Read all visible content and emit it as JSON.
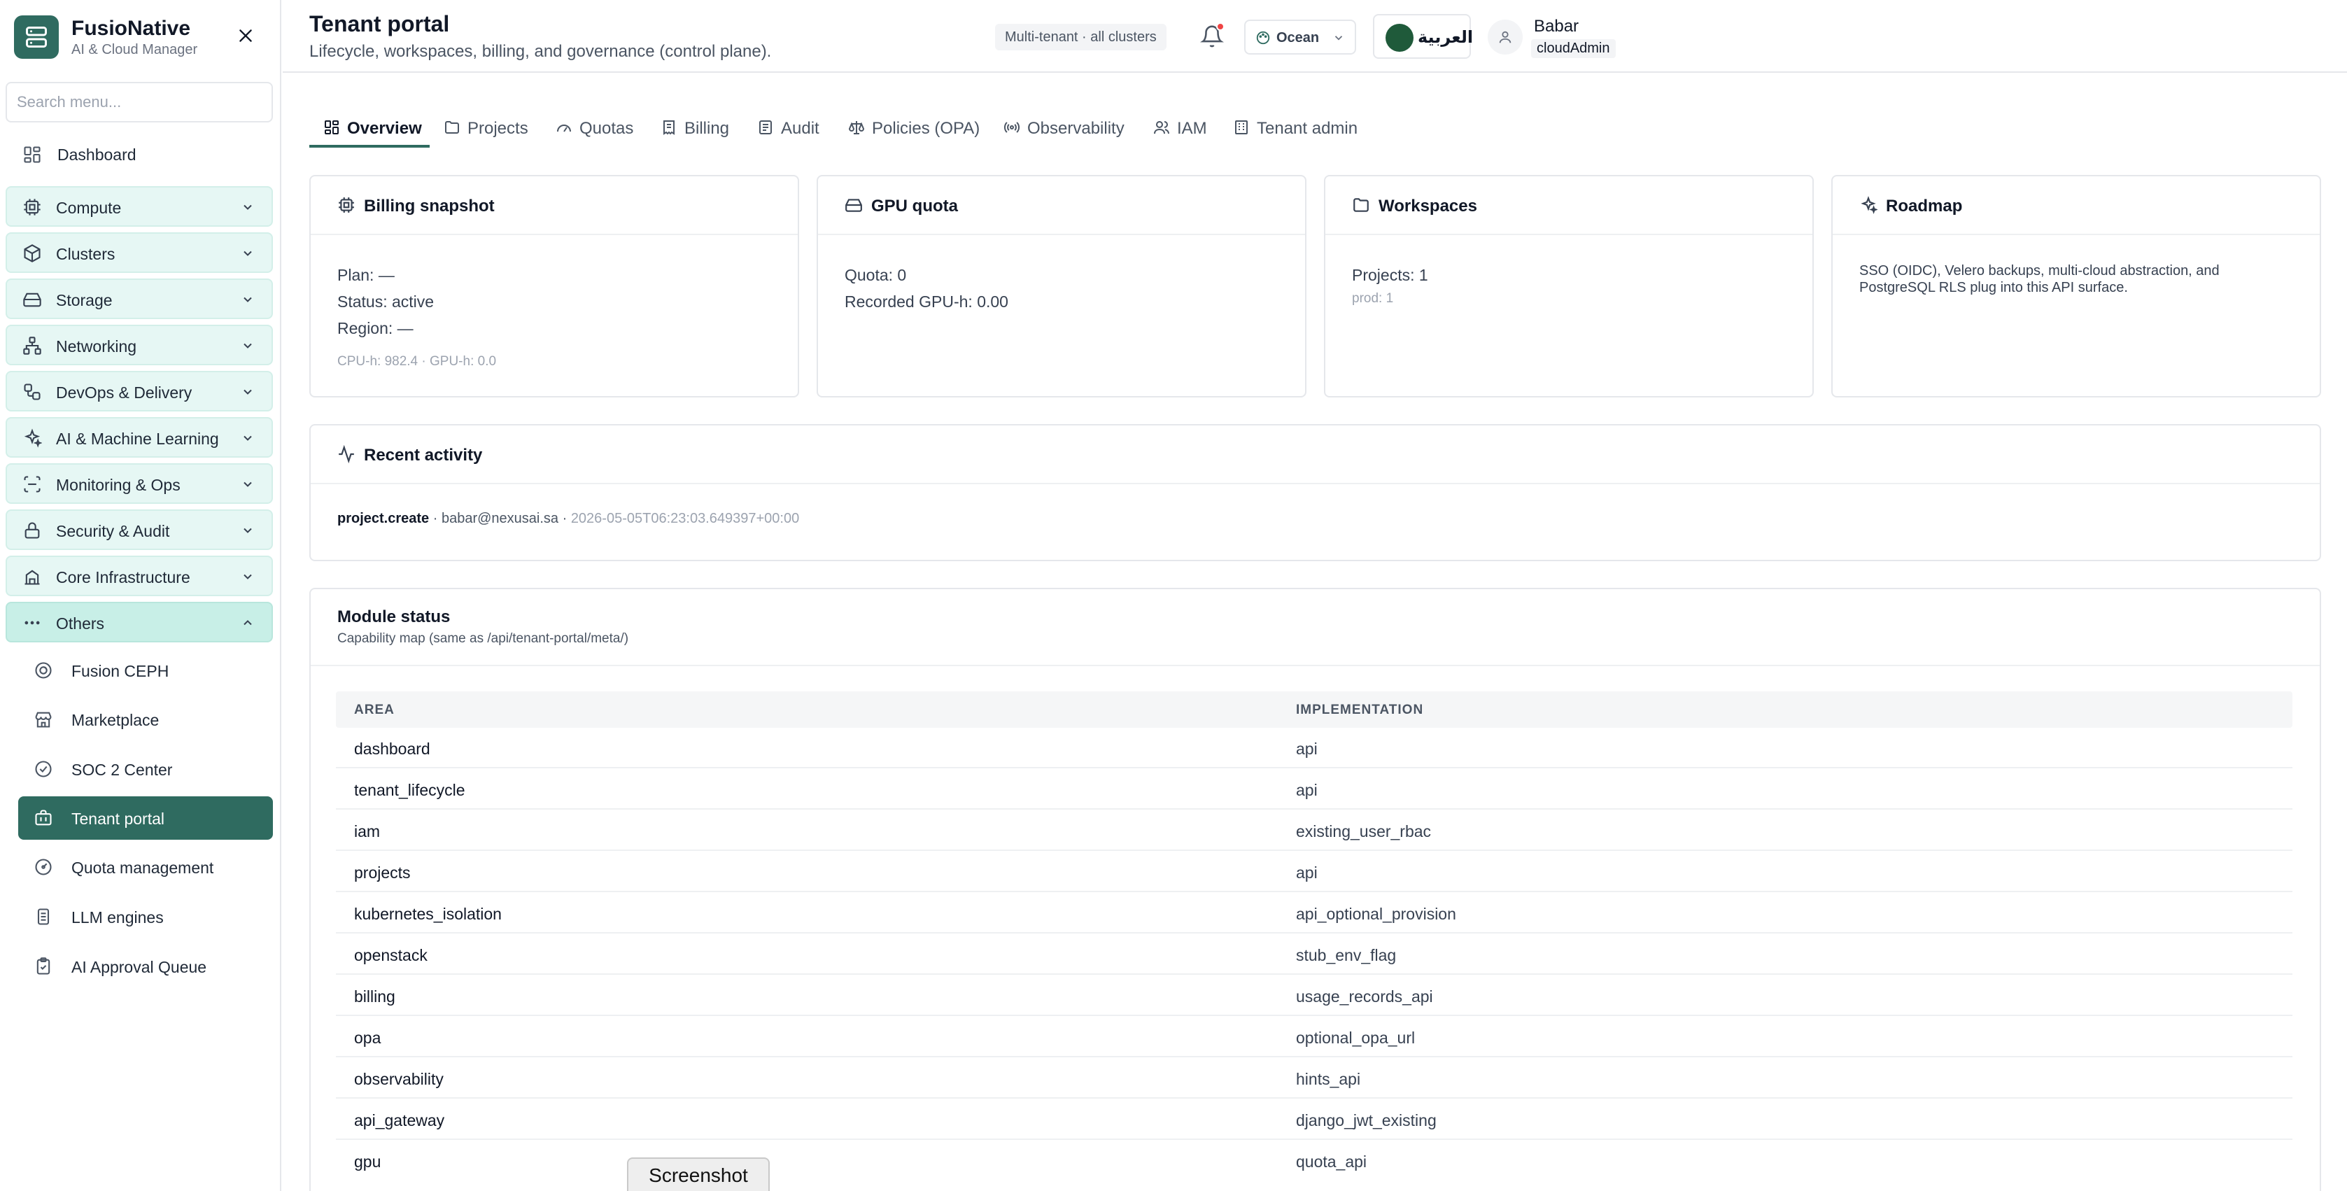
{
  "brand": {
    "name": "FusioNative",
    "subtitle": "AI & Cloud Manager"
  },
  "sidebar": {
    "search_placeholder": "Search menu...",
    "dashboard": "Dashboard",
    "groups": [
      {
        "label": "Compute",
        "icon": "cpu-icon"
      },
      {
        "label": "Clusters",
        "icon": "cube-icon"
      },
      {
        "label": "Storage",
        "icon": "hard-drive-icon"
      },
      {
        "label": "Networking",
        "icon": "network-icon"
      },
      {
        "label": "DevOps & Delivery",
        "icon": "workflow-icon"
      },
      {
        "label": "AI & Machine Learning",
        "icon": "sparkles-icon"
      },
      {
        "label": "Monitoring & Ops",
        "icon": "scan-icon"
      },
      {
        "label": "Security & Audit",
        "icon": "lock-icon"
      },
      {
        "label": "Core Infrastructure",
        "icon": "server-icon"
      },
      {
        "label": "Others",
        "icon": "more-icon"
      }
    ],
    "sub_items": [
      {
        "label": "Fusion CEPH",
        "icon": "ceph-icon"
      },
      {
        "label": "Marketplace",
        "icon": "store-icon"
      },
      {
        "label": "SOC 2 Center",
        "icon": "check-circle-icon"
      },
      {
        "label": "Tenant portal",
        "icon": "briefcase-icon"
      },
      {
        "label": "Quota management",
        "icon": "gauge-icon"
      },
      {
        "label": "LLM engines",
        "icon": "database-icon"
      },
      {
        "label": "AI Approval Queue",
        "icon": "clipboard-check-icon"
      }
    ]
  },
  "header": {
    "title": "Tenant portal",
    "subtitle": "Lifecycle, workspaces, billing, and governance (control plane).",
    "scope": "Multi-tenant · all clusters",
    "theme": "Ocean",
    "language": "العربية",
    "user_name": "Babar",
    "user_role": "cloudAdmin"
  },
  "tabs": [
    "Overview",
    "Projects",
    "Quotas",
    "Billing",
    "Audit",
    "Policies (OPA)",
    "Observability",
    "IAM",
    "Tenant admin"
  ],
  "cards": {
    "billing": {
      "title": "Billing snapshot",
      "plan": "Plan: —",
      "status": "Status: active",
      "region": "Region: —",
      "usage": "CPU-h: 982.4 · GPU-h: 0.0"
    },
    "gpu": {
      "title": "GPU quota",
      "quota": "Quota: 0",
      "recorded": "Recorded GPU-h: 0.00"
    },
    "workspaces": {
      "title": "Workspaces",
      "projects": "Projects: 1",
      "breakdown": "prod: 1"
    },
    "roadmap": {
      "title": "Roadmap",
      "text_line1": "SSO (OIDC), Velero backups, multi-cloud abstraction, and",
      "text_line2": "PostgreSQL RLS plug into this API surface."
    }
  },
  "activity": {
    "title": "Recent activity",
    "action": "project.create",
    "actor": "· babar@nexusai.sa ·",
    "timestamp": "2026-05-05T06:23:03.649397+00:00"
  },
  "modules": {
    "title": "Module status",
    "subtitle": "Capability map (same as /api/tenant-portal/meta/)",
    "columns": [
      "AREA",
      "IMPLEMENTATION"
    ],
    "rows": [
      [
        "dashboard",
        "api"
      ],
      [
        "tenant_lifecycle",
        "api"
      ],
      [
        "iam",
        "existing_user_rbac"
      ],
      [
        "projects",
        "api"
      ],
      [
        "kubernetes_isolation",
        "api_optional_provision"
      ],
      [
        "openstack",
        "stub_env_flag"
      ],
      [
        "billing",
        "usage_records_api"
      ],
      [
        "opa",
        "optional_opa_url"
      ],
      [
        "observability",
        "hints_api"
      ],
      [
        "api_gateway",
        "django_jwt_existing"
      ],
      [
        "gpu",
        "quota_api"
      ]
    ]
  },
  "overlay": {
    "screenshot_label": "Screenshot"
  },
  "colors": {
    "accent": "#2f6b60",
    "nav_group_bg": "#e6f7f4",
    "notification": "#ef4444"
  }
}
